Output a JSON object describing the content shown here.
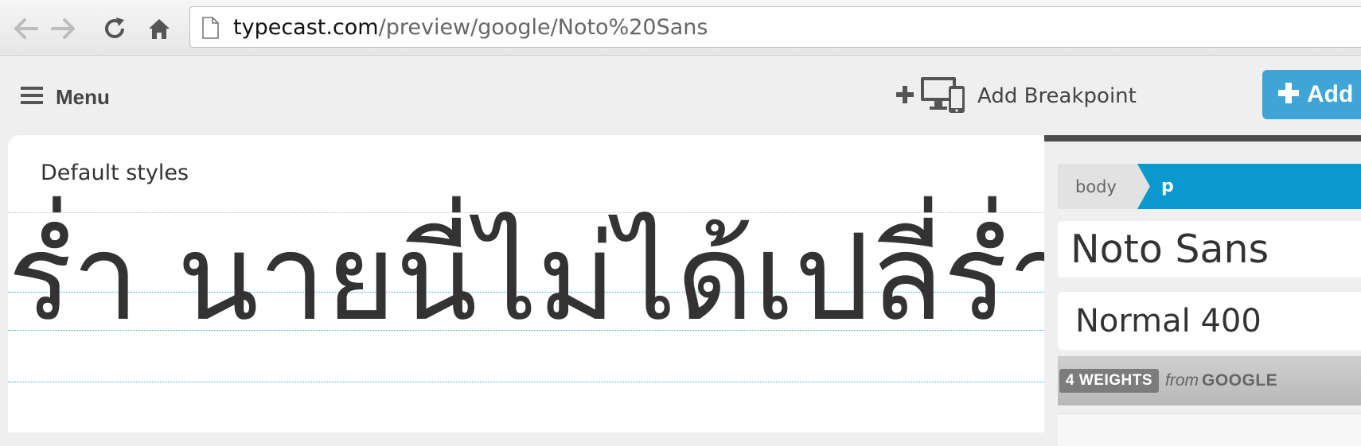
{
  "browser": {
    "url_domain": "typecast.com",
    "url_path": "/preview/google/Noto%20Sans"
  },
  "toolbar": {
    "menu_label": "Menu",
    "add_breakpoint_label": "Add Breakpoint",
    "add_button_label": "Add"
  },
  "canvas": {
    "section_title": "Default styles",
    "preview_text": "ร่ำ นายนี่ไม่ได้เปลี่ร่ำ"
  },
  "panel": {
    "breadcrumbs": [
      "body",
      "p"
    ],
    "font_name": "Noto Sans",
    "font_weight": "Normal 400",
    "weights_badge": "4 WEIGHTS",
    "from_label": "from",
    "source_label": "GOOGLE"
  },
  "colors": {
    "accent": "#3ea5d6",
    "breadcrumb_active": "#0a99cc",
    "guide_line": "#3aa9c9"
  },
  "icons": [
    "back-arrow-icon",
    "forward-arrow-icon",
    "reload-icon",
    "home-icon",
    "page-icon",
    "hamburger-icon",
    "plus-icon",
    "devices-icon"
  ]
}
